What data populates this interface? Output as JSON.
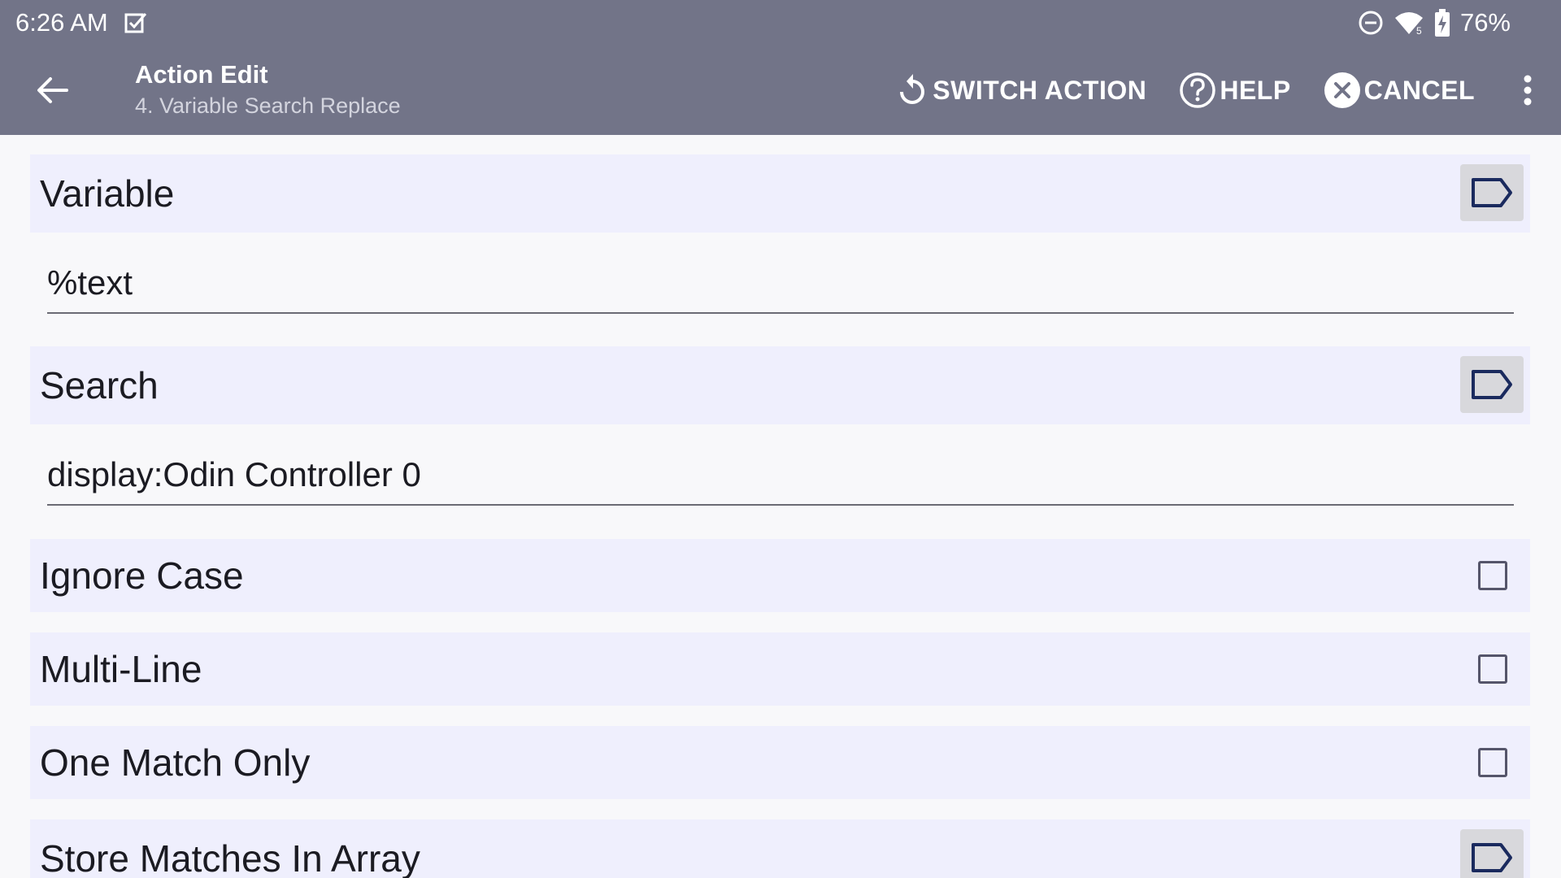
{
  "status_bar": {
    "time": "6:26 AM",
    "battery": "76%"
  },
  "toolbar": {
    "title": "Action Edit",
    "subtitle": "4. Variable Search Replace",
    "switch_action_label": "SWITCH ACTION",
    "help_label": "HELP",
    "cancel_label": "CANCEL"
  },
  "form": {
    "variable": {
      "label": "Variable",
      "value": "%text"
    },
    "search": {
      "label": "Search",
      "value": "display:Odin Controller 0"
    },
    "ignore_case": {
      "label": "Ignore Case",
      "checked": false
    },
    "multi_line": {
      "label": "Multi-Line",
      "checked": false
    },
    "one_match_only": {
      "label": "One Match Only",
      "checked": false
    },
    "store_matches": {
      "label": "Store Matches In Array"
    }
  },
  "icons": {
    "status_left": "checkbox-notification-icon",
    "status_right": [
      "do-not-disturb-icon",
      "wifi-icon",
      "battery-charging-icon"
    ],
    "toolbar": [
      "back-arrow-icon",
      "refresh-icon",
      "help-circle-icon",
      "cancel-circle-icon",
      "overflow-menu-icon"
    ],
    "row_action": "variable-tag-icon"
  },
  "colors": {
    "appbar": "#727488",
    "row_background": "#efeffd",
    "tag_icon": "#1a2a5e"
  }
}
